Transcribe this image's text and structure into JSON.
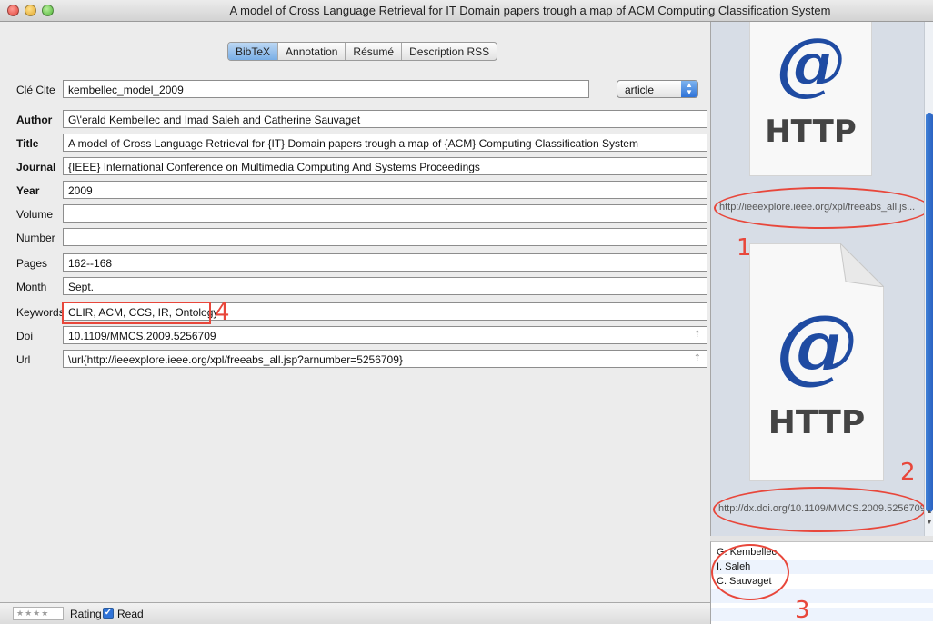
{
  "window": {
    "title": "A model of Cross Language Retrieval for IT Domain papers trough a map of ACM Computing Classification System"
  },
  "tabs": [
    "BibTeX",
    "Annotation",
    "Résumé",
    "Description RSS"
  ],
  "cite_key": {
    "label": "Clé Cite",
    "value": "kembellec_model_2009"
  },
  "entry_type": {
    "selected": "article"
  },
  "fields": [
    {
      "label": "Author",
      "value": "G\\'erald Kembellec and Imad Saleh and Catherine Sauvaget"
    },
    {
      "label": "Title",
      "value": "A model of Cross Language Retrieval for {IT} Domain papers trough a map of {ACM} Computing Classification System"
    },
    {
      "label": "Journal",
      "value": "{IEEE} International Conference on Multimedia Computing And Systems Proceedings"
    },
    {
      "label": "Year",
      "value": "2009"
    },
    {
      "label": "Volume",
      "value": ""
    },
    {
      "label": "Number",
      "value": ""
    },
    {
      "label": "Pages",
      "value": "162--168"
    },
    {
      "label": "Month",
      "value": "Sept."
    },
    {
      "label": "Keywords",
      "value": "CLIR, ACM, CCS, IR, Ontology"
    },
    {
      "label": "Doi",
      "value": "10.1109/MMCS.2009.5256709"
    },
    {
      "label": "Url",
      "value": "\\url{http://ieeexplore.ieee.org/xpl/freeabs_all.jsp?arnumber=5256709}"
    }
  ],
  "status": {
    "rating_stars": "★★★★",
    "rating_label": "Rating",
    "read_checked": true,
    "read_label": "Read"
  },
  "linked_files": [
    {
      "icon_at": "@",
      "icon_label": "HTTP",
      "url": "http://ieeexplore.ieee.org/xpl/freeabs_all.js..."
    },
    {
      "icon_at": "@",
      "icon_label": "HTTP",
      "url": "http://dx.doi.org/10.1109/MMCS.2009.5256709"
    }
  ],
  "authors": [
    "G. Kembellec",
    "I. Saleh",
    "C. Sauvaget"
  ],
  "annotations": {
    "color": "#e8473b",
    "numbers": [
      "1",
      "2",
      "3",
      "4"
    ]
  }
}
